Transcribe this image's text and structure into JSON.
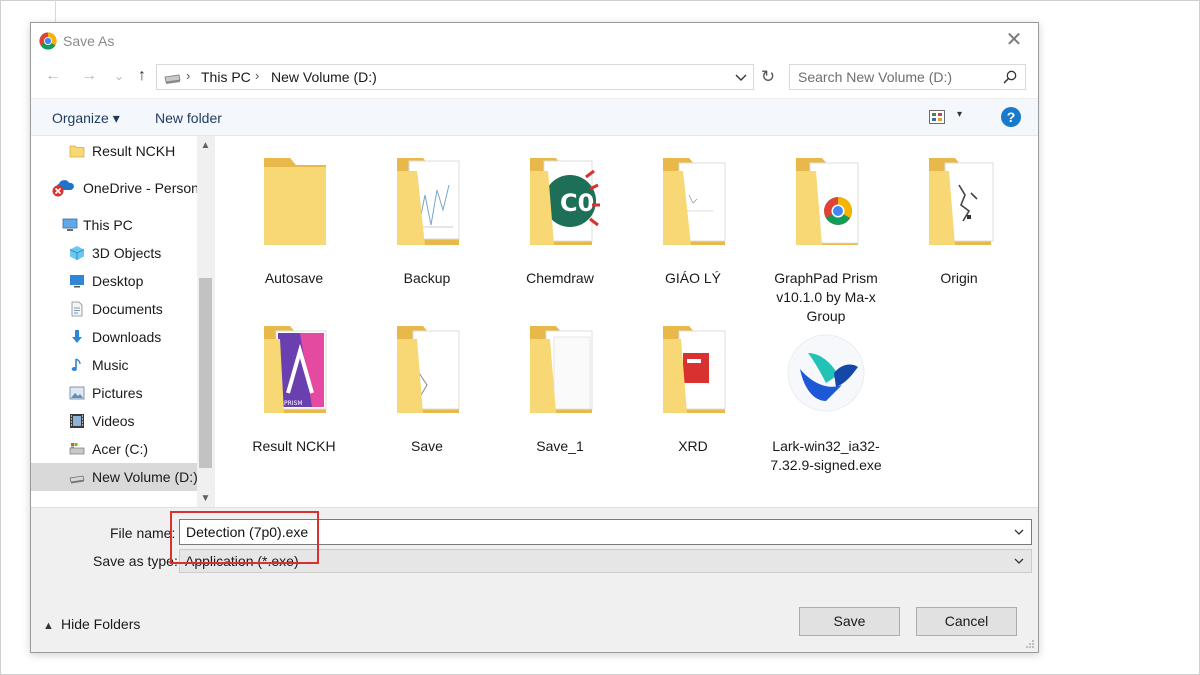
{
  "window": {
    "title": "Save As",
    "close_symbol": "✕"
  },
  "nav": {
    "back": "←",
    "forward": "→",
    "recent": "⌄",
    "up": "↑",
    "refresh": "↻",
    "breadcrumb": [
      "This PC",
      "New Volume (D:)"
    ],
    "breadcrumb_sep": "›",
    "search_placeholder": "Search New Volume (D:)"
  },
  "toolbar": {
    "organize_label": "Organize ▾",
    "new_folder_label": "New folder",
    "view_arrow": "▾",
    "help_label": "?"
  },
  "sidebar": {
    "scroll_up": "▲",
    "scroll_down": "▼",
    "items": [
      {
        "label": "Result NCKH",
        "icon": "folder-icon"
      },
      {
        "label": "OneDrive - Person",
        "icon": "onedrive-icon"
      },
      {
        "label": "This PC",
        "icon": "this-pc-icon"
      },
      {
        "label": "3D Objects",
        "icon": "3d-objects-icon"
      },
      {
        "label": "Desktop",
        "icon": "desktop-icon"
      },
      {
        "label": "Documents",
        "icon": "documents-icon"
      },
      {
        "label": "Downloads",
        "icon": "downloads-icon"
      },
      {
        "label": "Music",
        "icon": "music-icon"
      },
      {
        "label": "Pictures",
        "icon": "pictures-icon"
      },
      {
        "label": "Videos",
        "icon": "videos-icon"
      },
      {
        "label": "Acer (C:)",
        "icon": "drive-c-icon"
      },
      {
        "label": "New Volume (D:)",
        "icon": "drive-d-icon",
        "selected": true
      }
    ]
  },
  "files": [
    {
      "name": "Autosave",
      "type": "folder"
    },
    {
      "name": "Backup",
      "type": "folder"
    },
    {
      "name": "Chemdraw",
      "type": "folder"
    },
    {
      "name": "GIÁO LÝ",
      "type": "folder"
    },
    {
      "name": "GraphPad Prism v10.1.0 by Ma-x Group",
      "type": "folder"
    },
    {
      "name": "Origin",
      "type": "folder"
    },
    {
      "name": "Result NCKH",
      "type": "folder"
    },
    {
      "name": "Save",
      "type": "folder"
    },
    {
      "name": "Save_1",
      "type": "folder"
    },
    {
      "name": "XRD",
      "type": "folder"
    },
    {
      "name": "Lark-win32_ia32-7.32.9-signed.exe",
      "type": "exe"
    }
  ],
  "form": {
    "file_name_label": "File name:",
    "file_name_value": "Detection (7p0).exe",
    "save_type_label": "Save as type:",
    "save_type_value": "Application (*.exe)",
    "hide_folders_caret": "▲",
    "hide_folders_label": "Hide Folders",
    "save_label": "Save",
    "cancel_label": "Cancel"
  },
  "colors": {
    "folder": "#f8d775",
    "folder_dark": "#e8b84a",
    "accent": "#1979ca",
    "highlight_border": "#d93030"
  }
}
